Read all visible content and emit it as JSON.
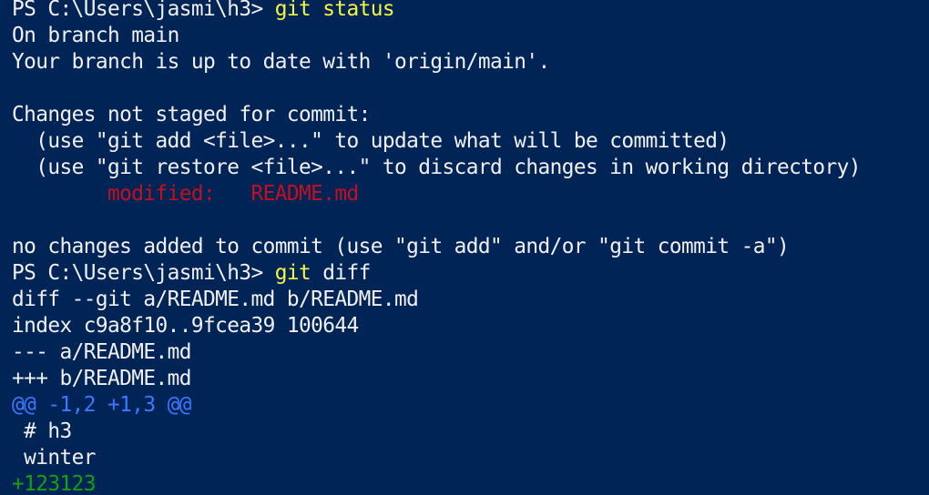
{
  "colors": {
    "background": "#012456",
    "default_text": "#f0f0f0",
    "command": "#f5f543",
    "modified": "#c50f1f",
    "hunk_header": "#3b78ff",
    "added_line": "#13a10e"
  },
  "terminal": {
    "prompt": "PS C:\\Users\\jasmi\\h3> ",
    "commands": {
      "status": "git status",
      "diff_cmd": "git",
      "diff_arg": " diff"
    },
    "status_output": {
      "branch": "On branch main",
      "up_to_date": "Your branch is up to date with 'origin/main'.",
      "not_staged_header": "Changes not staged for commit:",
      "hint_add": "  (use \"git add <file>...\" to update what will be committed)",
      "hint_restore": "  (use \"git restore <file>...\" to discard changes in working directory)",
      "modified_line": "        modified:   README.md",
      "no_changes": "no changes added to commit (use \"git add\" and/or \"git commit -a\")"
    },
    "diff_output": {
      "diff_header": "diff --git a/README.md b/README.md",
      "index": "index c9a8f10..9fcea39 100644",
      "old_file": "--- a/README.md",
      "new_file": "+++ b/README.md",
      "hunk": "@@ -1,2 +1,3 @@",
      "context_1": " # h3",
      "context_2": " winter",
      "added": "+123123"
    }
  }
}
